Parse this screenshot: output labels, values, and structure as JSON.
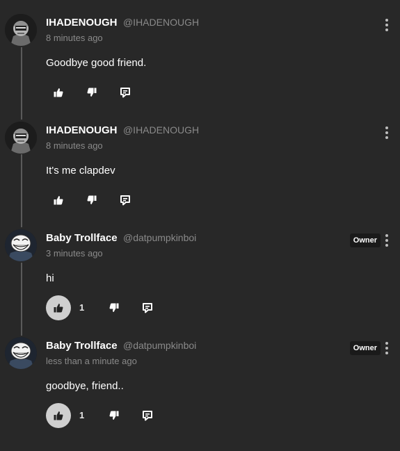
{
  "comments": [
    {
      "username": "IHADENOUGH",
      "handle": "@IHADENOUGH",
      "time": "8 minutes ago",
      "text": "Goodbye good friend.",
      "avatar": "ghost-avatar",
      "badge": "",
      "likes": "",
      "liked": false
    },
    {
      "username": "IHADENOUGH",
      "handle": "@IHADENOUGH",
      "time": "8 minutes ago",
      "text": "It's me clapdev",
      "avatar": "ghost-avatar",
      "badge": "",
      "likes": "",
      "liked": false
    },
    {
      "username": "Baby Trollface",
      "handle": "@datpumpkinboi",
      "time": "3 minutes ago",
      "text": "hi",
      "avatar": "trollface-avatar",
      "badge": "Owner",
      "likes": "1",
      "liked": true
    },
    {
      "username": "Baby Trollface",
      "handle": "@datpumpkinboi",
      "time": "less than a minute ago",
      "text": "goodbye, friend..",
      "avatar": "trollface-avatar",
      "badge": "Owner",
      "likes": "1",
      "liked": true
    }
  ],
  "icons": {
    "like": "thumbs-up-icon",
    "dislike": "thumbs-down-icon",
    "reply": "reply-icon",
    "more": "more-vertical-icon"
  },
  "colors": {
    "background": "#282828",
    "liked_bg": "#cfcfcf",
    "muted_text": "#8a8a8a"
  }
}
